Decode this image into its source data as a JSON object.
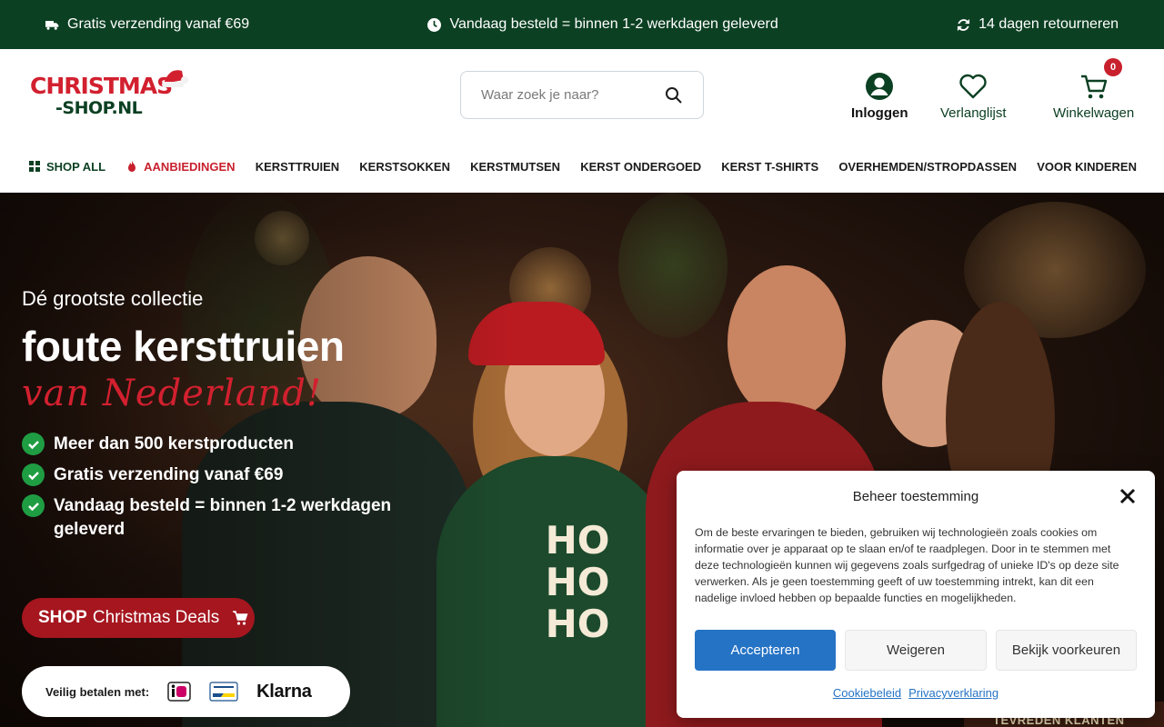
{
  "topbar": {
    "items": [
      {
        "icon": "truck-icon",
        "text": "Gratis verzending vanaf €69"
      },
      {
        "icon": "clock-icon",
        "text": "Vandaag besteld = binnen 1-2 werkdagen geleverd"
      },
      {
        "icon": "refresh-icon",
        "text": "14 dagen retourneren"
      }
    ]
  },
  "header": {
    "logo_line1": "CHRISTMAS",
    "logo_line2": "-SHOP.NL",
    "search_placeholder": "Waar zoek je naar?",
    "login_label": "Inloggen",
    "wishlist_label": "Verlanglijst",
    "cart_label": "Winkelwagen",
    "cart_count": "0"
  },
  "nav": {
    "items": [
      {
        "label": "SHOP ALL",
        "icon": "grid-icon"
      },
      {
        "label": "AANBIEDINGEN",
        "icon": "flame-icon"
      },
      {
        "label": "KERSTTRUIEN"
      },
      {
        "label": "KERSTSOKKEN"
      },
      {
        "label": "KERSTMUTSEN"
      },
      {
        "label": "KERST ONDERGOED"
      },
      {
        "label": "KERST T-SHIRTS"
      },
      {
        "label": "OVERHEMDEN/STROPDASSEN"
      },
      {
        "label": "VOOR KINDEREN"
      }
    ]
  },
  "hero": {
    "subtitle": "Dé grootste collectie",
    "title": "foute kersttruien",
    "script": "van Nederland!",
    "checks": [
      "Meer dan 500 kerstproducten",
      "Gratis verzending vanaf €69",
      "Vandaag besteld = binnen 1-2 werkdagen geleverd"
    ],
    "cta_bold": "SHOP",
    "cta_rest": "Christmas Deals",
    "pay_label": "Veilig betalen met:",
    "pay_klarna": "Klarna",
    "sweater_text": "HO HO HO",
    "review_peek": "TEVREDEN KLANTEN"
  },
  "cookie": {
    "title": "Beheer toestemming",
    "body": "Om de beste ervaringen te bieden, gebruiken wij technologieën zoals cookies om informatie over je apparaat op te slaan en/of te raadplegen. Door in te stemmen met deze technologieën kunnen wij gegevens zoals surfgedrag of unieke ID's op deze site verwerken. Als je geen toestemming geeft of uw toestemming intrekt, kan dit een nadelige invloed hebben op bepaalde functies en mogelijkheden.",
    "accept": "Accepteren",
    "deny": "Weigeren",
    "prefs": "Bekijk voorkeuren",
    "link1": "Cookiebeleid",
    "link2": "Privacyverklaring"
  },
  "colors": {
    "topbar_bg": "#0c4023",
    "brand_red": "#c8202d",
    "accept_blue": "#2573c5"
  }
}
